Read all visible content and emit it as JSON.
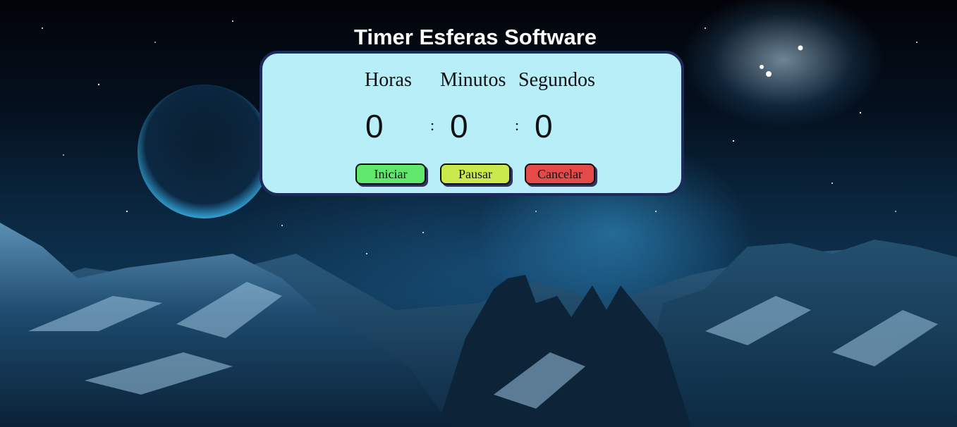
{
  "page": {
    "title": "Timer Esferas Software"
  },
  "timer": {
    "labels": {
      "hours": "Horas",
      "minutes": "Minutos",
      "seconds": "Segundos"
    },
    "values": {
      "hours": "0",
      "minutes": "0",
      "seconds": "0"
    },
    "separator": ":"
  },
  "controls": {
    "start_label": "Iniciar",
    "pause_label": "Pausar",
    "cancel_label": "Cancelar"
  },
  "colors": {
    "panel_bg": "#b8eef8",
    "panel_border": "#1f2a5c",
    "start_button": "#5fe86c",
    "pause_button": "#c9e94c",
    "cancel_button": "#e54a4a"
  }
}
